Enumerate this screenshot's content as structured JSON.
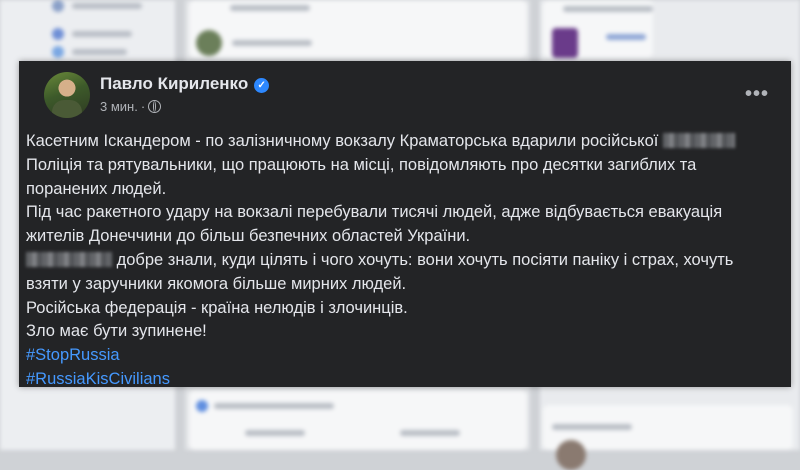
{
  "post": {
    "author": "Павло Кириленко",
    "verified": true,
    "time": "3 мин.",
    "visibility_icon": "globe-icon",
    "more_icon": "more-options-icon",
    "lines": [
      {
        "text": "Касетним Іскандером - по залізничному вокзалу Краматорська вдарили російської ",
        "redacted": true
      },
      {
        "text": "Поліція та рятувальники, що працюють на місці, повідомляють про десятки загиблих та"
      },
      {
        "text": "поранених людей."
      },
      {
        "text": "Під час ракетного удару на вокзалі перебували тисячі людей, адже відбувається  евакуація"
      },
      {
        "text": "жителів Донеччини до більш безпечних областей України."
      },
      {
        "text": " добре знали, куди цілять і чого хочуть: вони хочуть посіяти паніку і страх, хочуть",
        "redacted_start": true
      },
      {
        "text": "взяти у заручники якомога більше мирних людей."
      },
      {
        "text": "Російська федерація - країна нелюдів і злочинців."
      },
      {
        "text": "Зло має бути зупинене!"
      }
    ],
    "hashtags": [
      "#StopRussia",
      "#RussiaKisCivilians"
    ]
  },
  "colors": {
    "card_bg": "#232426",
    "text": "#e4e6eb",
    "secondary": "#b0b3b8",
    "hashtag": "#4599ff",
    "verified": "#2d88ff"
  }
}
